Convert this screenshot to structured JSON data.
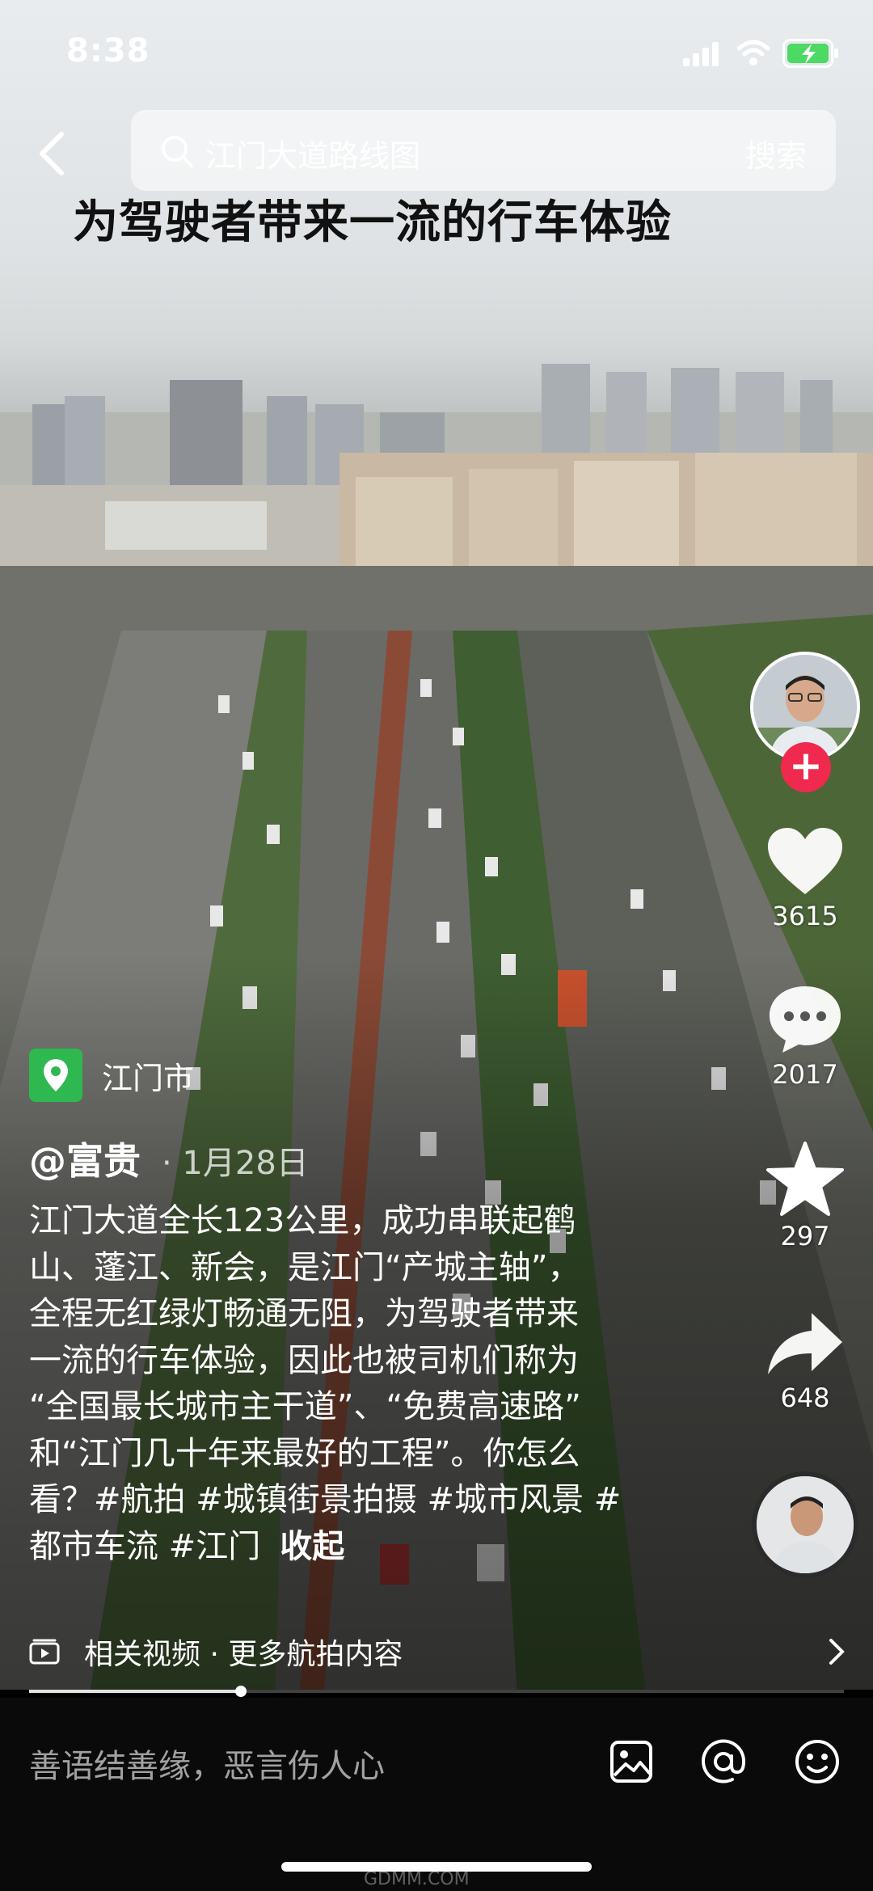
{
  "status_bar": {
    "time": "8:38"
  },
  "search": {
    "query": "江门大道路线图",
    "button_label": "搜索"
  },
  "video": {
    "overlay_caption": "为驾驶者带来一流的行车体验",
    "progress_fraction": 0.26
  },
  "actions": {
    "likes": "3615",
    "comments": "2017",
    "favorites": "297",
    "shares": "648",
    "follow_symbol": "+"
  },
  "location": {
    "label": "江门市"
  },
  "post": {
    "author": "@富贵",
    "date": "· 1月28日",
    "description_lines": [
      "江门大道全长123公里，成功串联起鹤",
      "山、蓬江、新会，是江门“产城主轴”，",
      "全程无红绿灯畅通无阻，为驾驶者带来",
      "一流的行车体验，因此也被司机们称为",
      "“全国最长城市主干道”、“免费高速路”",
      "和“江门几十年来最好的工程”。你怎么",
      "看？#航拍 #城镇街景拍摄 #城市风景 #",
      "都市车流 #江门"
    ],
    "collapse_label": "收起"
  },
  "related": {
    "label": "相关视频 · 更多航拍内容"
  },
  "comment_bar": {
    "placeholder": "善语结善缘，恶言伤人心"
  },
  "watermark": "GDMM.COM",
  "icons": {
    "back": "back-icon",
    "search": "search-icon",
    "like": "heart-icon",
    "comment": "comment-icon",
    "favorite": "star-icon",
    "share": "share-icon",
    "location": "location-pin-icon",
    "related": "video-icon",
    "image": "image-icon",
    "mention": "at-icon",
    "emoji": "emoji-icon"
  },
  "colors": {
    "follow": "#f0294f",
    "location": "#2eb84f",
    "battery": "#4cd964"
  }
}
